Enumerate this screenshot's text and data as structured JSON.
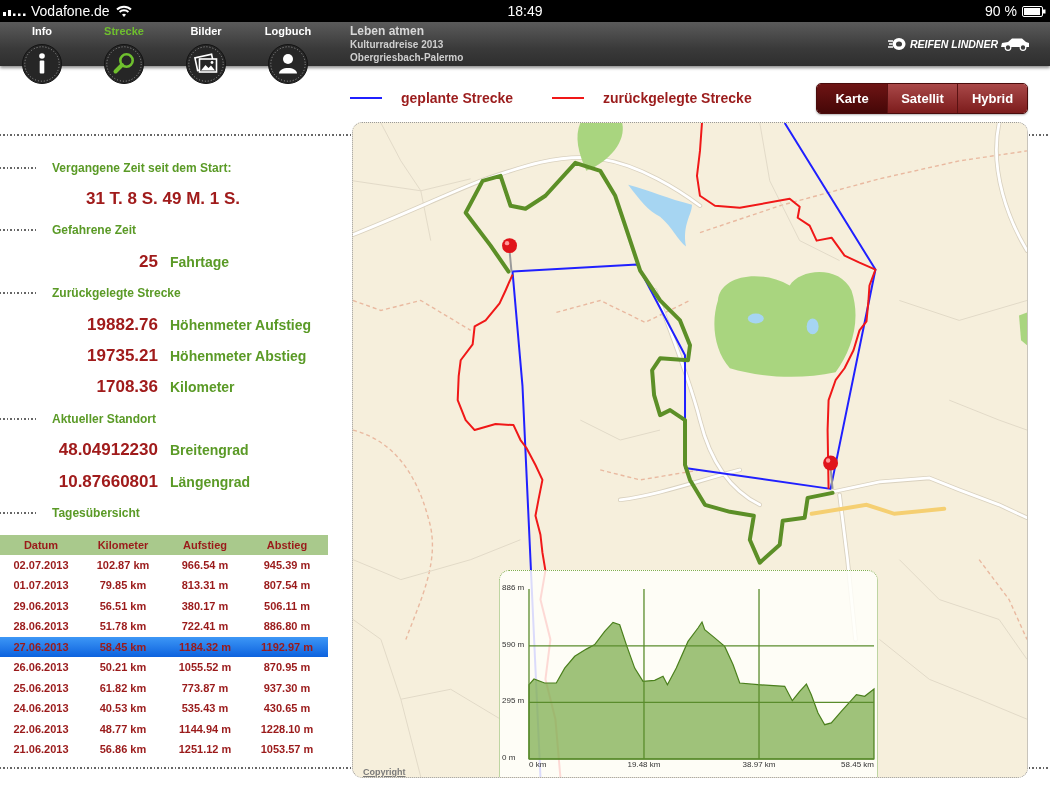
{
  "status_bar": {
    "carrier": "Vodafone.de",
    "time": "18:49",
    "battery": "90 %"
  },
  "toolbar": {
    "tabs": [
      {
        "label": "Info",
        "selected": false
      },
      {
        "label": "Strecke",
        "selected": true
      },
      {
        "label": "Bilder",
        "selected": false
      },
      {
        "label": "Logbuch",
        "selected": false
      }
    ],
    "title": "Leben atmen",
    "subtitle": [
      "Kulturradreise 2013",
      "Obergriesbach-Palermo"
    ],
    "logo": "REIFEN LINDNER"
  },
  "summary": {
    "sections": [
      {
        "heading": "Vergangene Zeit seit dem Start:",
        "rows": [
          {
            "kind": "duration",
            "value": "31 T. 8 S. 49 M. 1 S."
          }
        ]
      },
      {
        "heading": "Gefahrene Zeit",
        "rows": [
          {
            "kind": "measure",
            "value": "25",
            "unit": "Fahrtage"
          }
        ]
      },
      {
        "heading": "Zurückgelegte Strecke",
        "rows": [
          {
            "kind": "measure",
            "value": "19882.76",
            "unit": "Höhenmeter Aufstieg"
          },
          {
            "kind": "measure",
            "value": "19735.21",
            "unit": "Höhenmeter Abstieg"
          },
          {
            "kind": "measure",
            "value": "1708.36",
            "unit": "Kilometer"
          }
        ]
      },
      {
        "heading": "Aktueller Standort",
        "rows": [
          {
            "kind": "measure",
            "value": "48.04912230",
            "unit": "Breitengrad"
          },
          {
            "kind": "measure",
            "value": "10.87660801",
            "unit": "Längengrad"
          }
        ]
      },
      {
        "heading": "Tagesübersicht",
        "table": {
          "columns": [
            "Datum",
            "Kilometer",
            "Aufstieg",
            "Abstieg"
          ],
          "rows": [
            {
              "cells": [
                "02.07.2013",
                "102.87 km",
                "966.54 m",
                "945.39 m"
              ],
              "selected": false
            },
            {
              "cells": [
                "01.07.2013",
                "79.85 km",
                "813.31 m",
                "807.54 m"
              ],
              "selected": false
            },
            {
              "cells": [
                "29.06.2013",
                "56.51 km",
                "380.17 m",
                "506.11 m"
              ],
              "selected": false
            },
            {
              "cells": [
                "28.06.2013",
                "51.78 km",
                "722.41 m",
                "886.80 m"
              ],
              "selected": false
            },
            {
              "cells": [
                "27.06.2013",
                "58.45 km",
                "1184.32 m",
                "1192.97 m"
              ],
              "selected": true
            },
            {
              "cells": [
                "26.06.2013",
                "50.21 km",
                "1055.52 m",
                "870.95 m"
              ],
              "selected": false
            },
            {
              "cells": [
                "25.06.2013",
                "61.82 km",
                "773.87 m",
                "937.30 m"
              ],
              "selected": false
            },
            {
              "cells": [
                "24.06.2013",
                "40.53 km",
                "535.43 m",
                "430.65 m"
              ],
              "selected": false
            },
            {
              "cells": [
                "22.06.2013",
                "48.77 km",
                "1144.94 m",
                "1228.10 m"
              ],
              "selected": false
            },
            {
              "cells": [
                "21.06.2013",
                "56.86 km",
                "1251.12 m",
                "1053.57 m"
              ],
              "selected": false
            }
          ]
        }
      }
    ]
  },
  "map": {
    "legend": [
      {
        "label": "geplante Strecke",
        "color": "#2020ff"
      },
      {
        "label": "zurückgelegte Strecke",
        "color": "#f01818"
      }
    ],
    "map_types": [
      {
        "label": "Karte",
        "selected": true
      },
      {
        "label": "Satellit",
        "selected": false
      },
      {
        "label": "Hybrid",
        "selected": false
      }
    ],
    "copyright": "Copyright",
    "elevation_profile": {
      "chart_data": {
        "type": "area",
        "x": [
          0,
          0.85,
          2.65,
          4.63,
          6.04,
          7.74,
          9.71,
          11.13,
          12.82,
          14.23,
          15.36,
          16.49,
          17.9,
          19.31,
          21.29,
          22.7,
          23.44,
          24.96,
          26.94,
          28.63,
          29.31,
          29.76,
          31.46,
          33.15,
          34.56,
          35.69,
          38.8,
          43.32,
          44.61,
          45.86,
          46.99,
          47.83,
          48.96,
          50.09,
          51.22,
          52.91,
          55.46,
          56.87,
          58.45
        ],
        "values": [
          387,
          417,
          396,
          396,
          474,
          535,
          573,
          596,
          665,
          712,
          700,
          596,
          474,
          405,
          410,
          431,
          387,
          474,
          613,
          683,
          714,
          674,
          631,
          587,
          492,
          396,
          387,
          379,
          304,
          353,
          391,
          335,
          240,
          179,
          188,
          248,
          335,
          327,
          365
        ],
        "xlim": [
          0,
          58.45
        ],
        "ylim": [
          0,
          886
        ],
        "xticks": [
          {
            "value": 0,
            "label": "0 km"
          },
          {
            "value": 19.48,
            "label": "19.48 km"
          },
          {
            "value": 38.97,
            "label": "38.97 km"
          },
          {
            "value": 58.45,
            "label": "58.45 km"
          }
        ],
        "yticks": [
          {
            "value": 0,
            "label": "0 m"
          },
          {
            "value": 295,
            "label": "295 m"
          },
          {
            "value": 590,
            "label": "590 m"
          },
          {
            "value": 886,
            "label": "886 m"
          }
        ],
        "grid": true
      }
    }
  }
}
